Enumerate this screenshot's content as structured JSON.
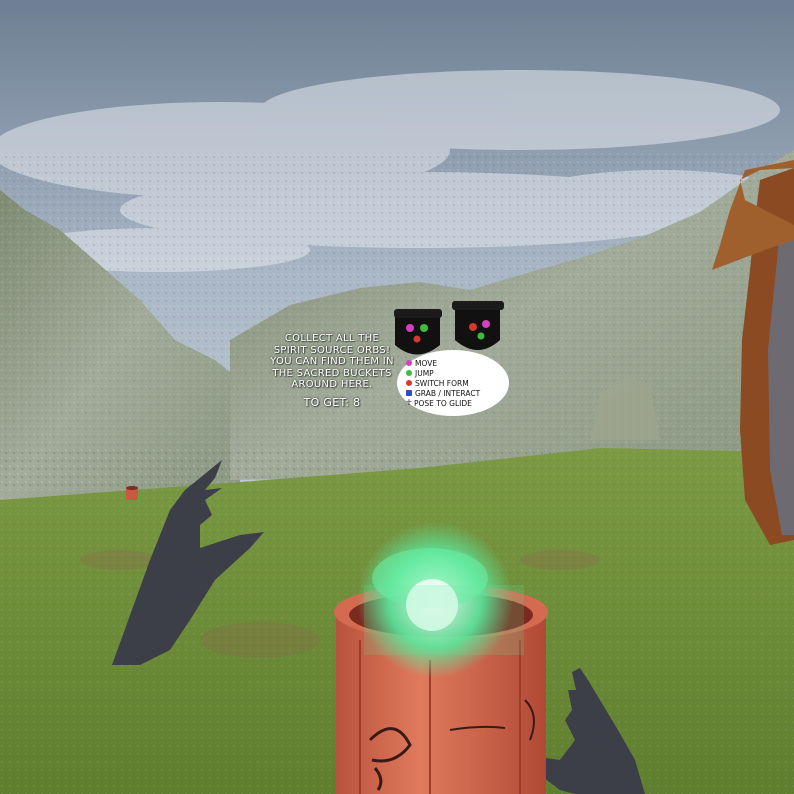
{
  "hud": {
    "instructions": [
      "Collect all the",
      "Spirit Source Orbs!",
      "You can find them in",
      "the sacred buckets",
      "around here."
    ],
    "goal_label": "To get:",
    "goal_count": "8"
  },
  "controls": [
    {
      "label": "Move",
      "color": "#d63fc0",
      "shape": "dot"
    },
    {
      "label": "Jump",
      "color": "#3bbf3b",
      "shape": "dot"
    },
    {
      "label": "Switch Form",
      "color": "#d23a2e",
      "shape": "dot"
    },
    {
      "label": "Grab / Interact",
      "color": "#2a4fc8",
      "shape": "square"
    },
    {
      "label": "Pose to Glide",
      "color": "#111111",
      "shape": "glyph",
      "glyph": "☥"
    }
  ],
  "colors": {
    "sky": "#8fa1b8",
    "grass": "#6e8f3a",
    "rock": "#8d9a88",
    "bucket": "#d2694e",
    "orb": "#5fe8a0",
    "hand": "#3d3f48"
  },
  "icons": {
    "controller_left": "vr-controller-icon",
    "controller_right": "vr-controller-icon",
    "orb": "glowing-orb",
    "bucket": "sacred-bucket"
  }
}
